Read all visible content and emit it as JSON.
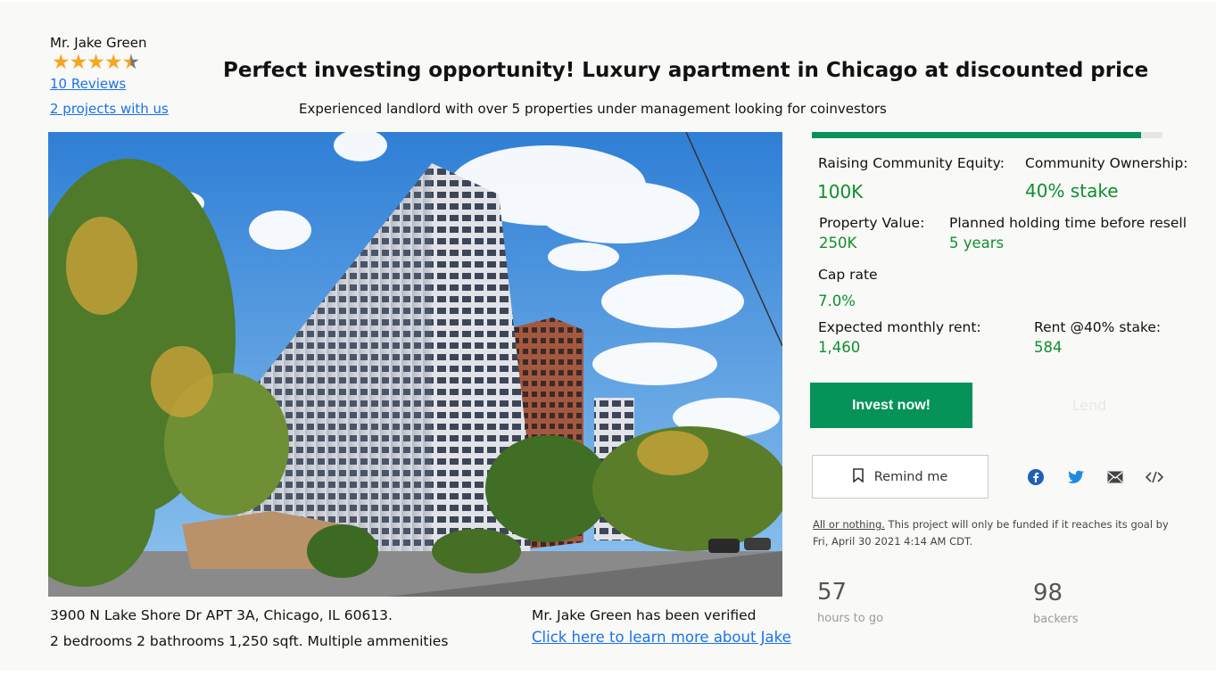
{
  "owner": {
    "name": "Mr. Jake Green",
    "rating": 4.5,
    "reviews_label": "10 Reviews",
    "projects_label": "2 projects with us"
  },
  "listing": {
    "title": "Perfect investing opportunity! Luxury apartment in Chicago at discounted price",
    "subtitle": "Experienced landlord with over 5 properties under management looking for coinvestors",
    "address": "3900 N Lake Shore Dr APT 3A, Chicago, IL 60613.",
    "details": "2 bedrooms 2 bathrooms  1,250 sqft. Multiple ammenities"
  },
  "funding": {
    "progress_fraction": 0.94,
    "raising_label": "Raising Community Equity:",
    "raising_value": "100K",
    "ownership_label": "Community Ownership:",
    "ownership_value": "40% stake",
    "property_value_label": "Property Value:",
    "property_value": "250K",
    "holding_label": "Planned holding time before resell",
    "holding_value": "5 years",
    "cap_rate_label": "Cap rate",
    "cap_rate_value": "7.0%",
    "rent_label": "Expected monthly  rent:",
    "rent_value": "1,460",
    "rent_stake_label": "Rent @40% stake:",
    "rent_stake_value": "584"
  },
  "actions": {
    "invest_label": "Invest now!",
    "lend_label": "Lend",
    "remind_label": "Remind me",
    "share_icons": [
      "facebook-icon",
      "twitter-icon",
      "email-icon",
      "embed-icon"
    ]
  },
  "notice": {
    "all_or_nothing": "All or nothing.",
    "text": " This project will only be funded if it reaches its goal by Fri, April 30 2021 4:14 AM CDT."
  },
  "stats": {
    "hours_value": "57",
    "hours_label": "hours to go",
    "backers_value": "98",
    "backers_label": "backers"
  },
  "verification": {
    "verified_text": "Mr. Jake Green has been verified",
    "learn_more": "Click here to learn more about Jake"
  },
  "colors": {
    "accent_green": "#05935a",
    "value_green": "#0f8f2e",
    "link_blue": "#1a73e8",
    "facebook_blue": "#1877f2",
    "twitter_blue": "#1da1f2"
  }
}
